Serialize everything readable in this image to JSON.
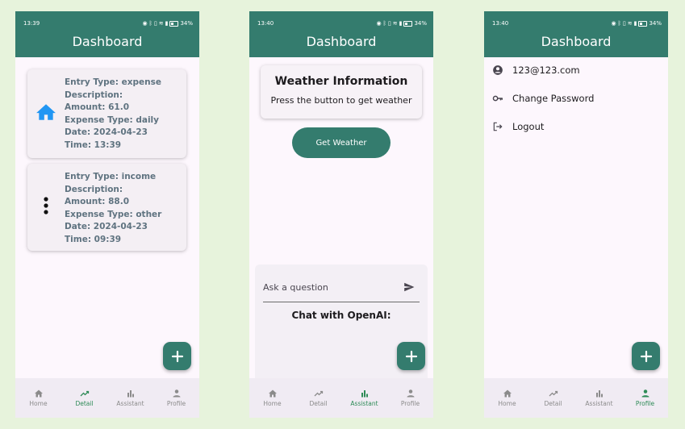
{
  "colors": {
    "primary": "#347c6e",
    "active_nav": "#2e8b57",
    "background": "#e7f3dc",
    "card_text": "#5f7380"
  },
  "screens": [
    {
      "status_time": "13:39",
      "battery": "34%",
      "title": "Dashboard",
      "entries": [
        {
          "icon": "home-icon",
          "lines": [
            "Entry Type: expense",
            "Description:",
            "Amount: 61.0",
            "Expense Type: daily",
            "Date: 2024-04-23",
            "Time: 13:39"
          ]
        },
        {
          "icon": "more-vert-icon",
          "lines": [
            "Entry Type: income",
            "Description:",
            "Amount: 88.0",
            "Expense Type: other",
            "Date: 2024-04-23",
            "Time: 09:39"
          ]
        }
      ]
    },
    {
      "status_time": "13:40",
      "battery": "34%",
      "title": "Dashboard",
      "weather_title": "Weather Information",
      "weather_subtitle": "Press the button to get weather",
      "get_weather_label": "Get Weather",
      "ask_placeholder": "Ask a question",
      "chat_title": "Chat with OpenAI:"
    },
    {
      "status_time": "13:40",
      "battery": "34%",
      "title": "Dashboard",
      "email": "123@123.com",
      "change_password": "Change Password",
      "logout": "Logout"
    }
  ],
  "nav": [
    {
      "label": "Home",
      "icon": "home-icon"
    },
    {
      "label": "Detail",
      "icon": "trending-up-icon"
    },
    {
      "label": "Assistant",
      "icon": "bar-chart-icon"
    },
    {
      "label": "Profile",
      "icon": "person-icon"
    }
  ],
  "active_nav": [
    "Detail",
    "Assistant",
    "Profile"
  ]
}
